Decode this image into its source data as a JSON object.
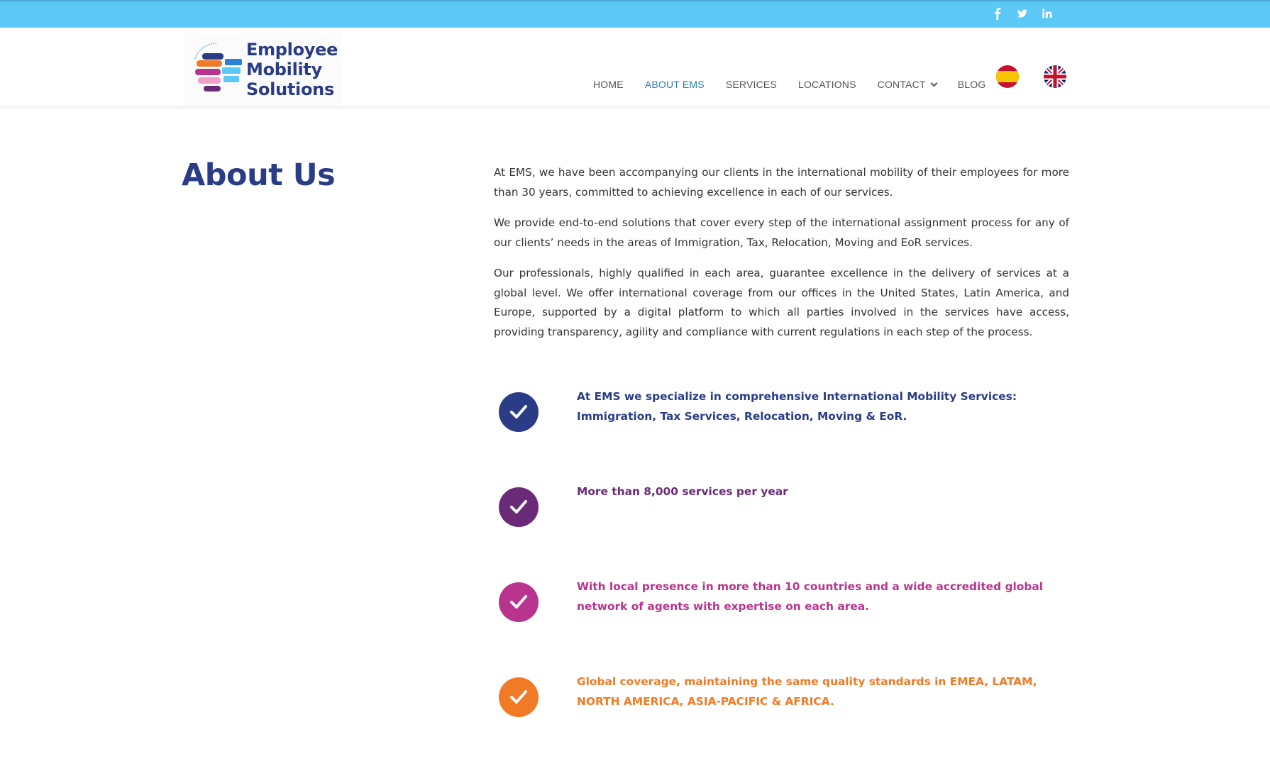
{
  "topbar": {
    "color": "#5bc8f5",
    "social": [
      {
        "name": "facebook-icon"
      },
      {
        "name": "twitter-icon"
      },
      {
        "name": "linkedin-icon"
      }
    ]
  },
  "header": {
    "logo": {
      "line1": "Employee",
      "line2": "Mobility",
      "line3": "Solutions"
    },
    "nav": [
      {
        "label": "HOME",
        "active": false
      },
      {
        "label": "ABOUT EMS",
        "active": true
      },
      {
        "label": "SERVICES",
        "active": false
      },
      {
        "label": "LOCATIONS",
        "active": false
      },
      {
        "label": "CONTACT",
        "active": false,
        "has_dropdown": true
      },
      {
        "label": "BLOG",
        "active": false
      }
    ],
    "languages": [
      {
        "name": "spanish-flag-icon"
      },
      {
        "name": "uk-flag-icon"
      }
    ]
  },
  "main": {
    "title": "About Us",
    "paragraphs": [
      "At EMS, we have been accompanying our clients in the international mobility of their employees for more than 30 years, committed to achieving excellence in each of our services.",
      "We provide end-to-end solutions that cover every step of the international assignment process for any of our clients’ needs in the areas of Immigration, Tax, Relocation, Moving and EoR services.",
      "Our professionals, highly qualified in each area, guarantee excellence in the delivery of services at a global level. We offer international coverage from our offices in the United States, Latin America, and Europe, supported by a digital platform to which all parties involved in the services have access, providing transparency, agility and compliance with current regulations in each step of the process."
    ],
    "features": [
      {
        "text": "At EMS we specialize in comprehensive International Mobility Services: Immigration, Tax Services, Relocation, Moving & EoR.",
        "color": "#2a3c86"
      },
      {
        "text": "More than 8,000 services per year",
        "color": "#6b2a78"
      },
      {
        "text": "With local presence in more than 10 countries and a wide accredited global network of agents with expertise on each area.",
        "color": "#b8348f"
      },
      {
        "text": "Global coverage, maintaining the same quality standards in EMEA, LATAM, NORTH AMERICA, ASIA-PACIFIC & AFRICA.",
        "color": "#f07a26"
      }
    ]
  },
  "colors": {
    "brand_blue": "#2a3c86",
    "nav_active": "#2a82b2",
    "purple": "#6b2a78",
    "magenta": "#b8348f",
    "orange": "#f07a26"
  }
}
